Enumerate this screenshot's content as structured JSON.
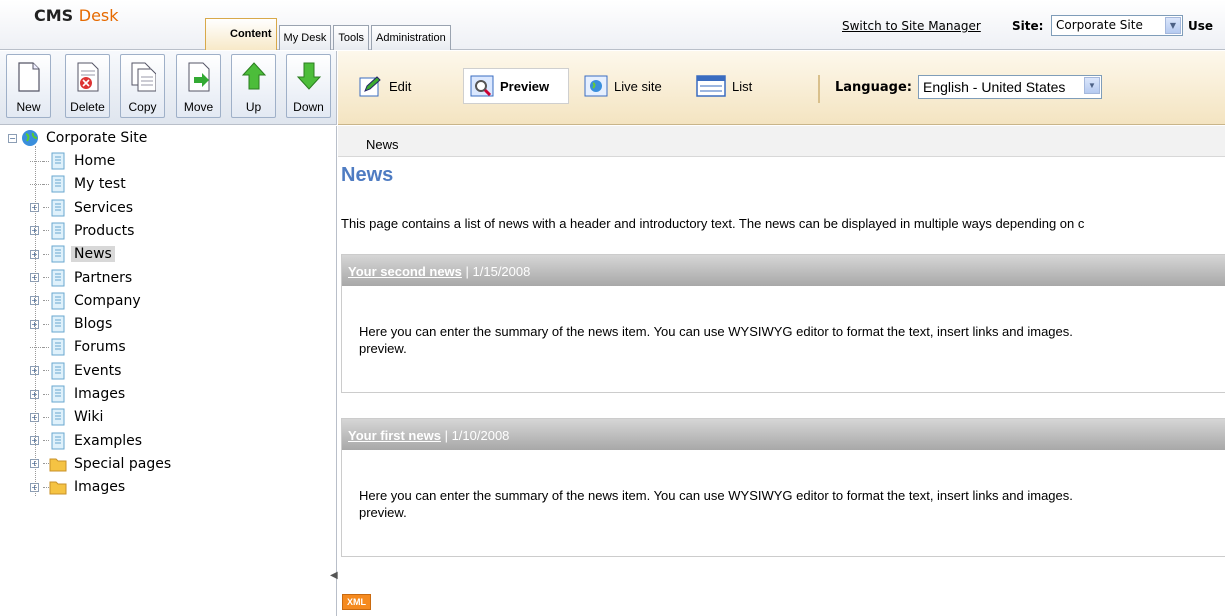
{
  "header": {
    "logo_cms": "CMS",
    "logo_desk": "Desk",
    "tabs": [
      {
        "label": "Content"
      },
      {
        "label": "My Desk"
      },
      {
        "label": "Tools"
      },
      {
        "label": "Administration"
      }
    ],
    "switch_link": "Switch to Site Manager",
    "site_label": "Site:",
    "site_value": "Corporate Site",
    "user_label": "Use"
  },
  "toolbar": {
    "buttons": [
      {
        "label": "New"
      },
      {
        "label": "Delete"
      },
      {
        "label": "Copy"
      },
      {
        "label": "Move"
      },
      {
        "label": "Up"
      },
      {
        "label": "Down"
      }
    ],
    "modes": [
      {
        "label": "Edit"
      },
      {
        "label": "Preview"
      },
      {
        "label": "Live site"
      },
      {
        "label": "List"
      }
    ],
    "language_label": "Language:",
    "language_value": "English - United States"
  },
  "tree": {
    "root": "Corporate Site",
    "items": [
      {
        "label": "Home"
      },
      {
        "label": "My test"
      },
      {
        "label": "Services"
      },
      {
        "label": "Products"
      },
      {
        "label": "News"
      },
      {
        "label": "Partners"
      },
      {
        "label": "Company"
      },
      {
        "label": "Blogs"
      },
      {
        "label": "Forums"
      },
      {
        "label": "Events"
      },
      {
        "label": "Images"
      },
      {
        "label": "Wiki"
      },
      {
        "label": "Examples"
      },
      {
        "label": "Special pages"
      },
      {
        "label": "Images"
      }
    ]
  },
  "content": {
    "breadcrumb": "News",
    "title": "News",
    "intro": "This page contains a list of news with a header and introductory text. The news can be displayed in multiple ways depending on c",
    "news": [
      {
        "title": "Your second news",
        "date": "| 1/15/2008",
        "summary_line1": "Here you can enter the summary of the news item. You can use WYSIWYG editor to format the text, insert links and images.",
        "summary_line2": "preview."
      },
      {
        "title": "Your first news",
        "date": "| 1/10/2008",
        "summary_line1": "Here you can enter the summary of the news item. You can use WYSIWYG editor to format the text, insert links and images.",
        "summary_line2": "preview."
      }
    ],
    "xml_badge": "XML"
  }
}
